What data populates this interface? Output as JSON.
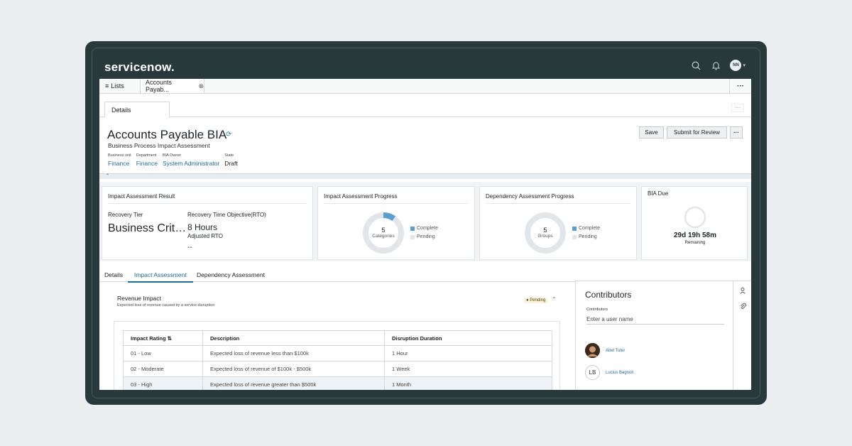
{
  "app": {
    "logo": "servicenow.",
    "avatar_initials": "NN"
  },
  "icons": {
    "search": "search-icon",
    "bell": "bell-icon",
    "chevron": "chevron-down-icon",
    "close": "close-icon",
    "tag": "tag-icon",
    "user": "user-icon",
    "paperclip": "paperclip-icon"
  },
  "tabs": {
    "lists": "Lists",
    "active": "Accounts Payab...",
    "more": "···"
  },
  "subtab": {
    "details": "Details",
    "more": "···"
  },
  "header": {
    "title": "Accounts Payable BIA",
    "subtitle": "Business Process Impact Assessment",
    "meta": [
      {
        "label": "Business unit",
        "value": "Finance"
      },
      {
        "label": "Department",
        "value": "Finance"
      },
      {
        "label": "BIA Owner",
        "value": "System Administrator"
      },
      {
        "label": "State",
        "value": "Draft"
      }
    ],
    "save_label": "Save",
    "submit_label": "Submit for Review",
    "more_label": "···"
  },
  "cards": {
    "result": {
      "title": "Impact Assessment Result",
      "recovery_tier_label": "Recovery Tier",
      "recovery_tier_value": "Business Crit…",
      "rto_label": "Recovery Time Objective(RTO)",
      "rto_value": "8 Hours",
      "adjusted_label": "Adjusted RTO",
      "adjusted_value": "--"
    },
    "impact_progress": {
      "title": "Impact Assessment Progress",
      "count": "5",
      "caption": "Categories",
      "complete_label": "Complete",
      "pending_label": "Pending",
      "complete_fraction": 0.1
    },
    "dependency_progress": {
      "title": "Dependency Assessment Progress",
      "count": "5",
      "caption": "Groups",
      "complete_label": "Complete",
      "pending_label": "Pending",
      "complete_fraction": 0.0
    },
    "bia_due": {
      "title": "BIA Due",
      "countdown": "29d 19h 58m",
      "caption": "Remaining"
    }
  },
  "colors": {
    "complete": "#5b9fd0",
    "pending": "#e3e6e8",
    "brand_dark": "#27393a",
    "link": "#1f6b9c"
  },
  "bottom_tabs": [
    "Details",
    "Impact Assessment",
    "Dependency Assessment"
  ],
  "revenue": {
    "title": "Revenue Impact",
    "subtitle": "Expected loss of revenue caused by a service disruption",
    "status": "Pending",
    "columns": [
      "Impact Rating ⇅",
      "Description",
      "Disruption Duration"
    ],
    "rows": [
      [
        "01 - Low",
        "Expected loss of revenue less than $100k",
        "1 Hour"
      ],
      [
        "02 - Moderate",
        "Expected loss of revenue of $100k - $500k",
        "1 Week"
      ],
      [
        "03 - High",
        "Expected loss of revenue greater than $500k",
        "1 Month"
      ]
    ]
  },
  "contributors": {
    "title": "Contributors",
    "field_label": "Contributors",
    "placeholder": "Enter a user name",
    "people": [
      {
        "name": "Abel Tuter",
        "initials": ""
      },
      {
        "name": "Lucius Bagnoli",
        "initials": "LB"
      }
    ]
  }
}
